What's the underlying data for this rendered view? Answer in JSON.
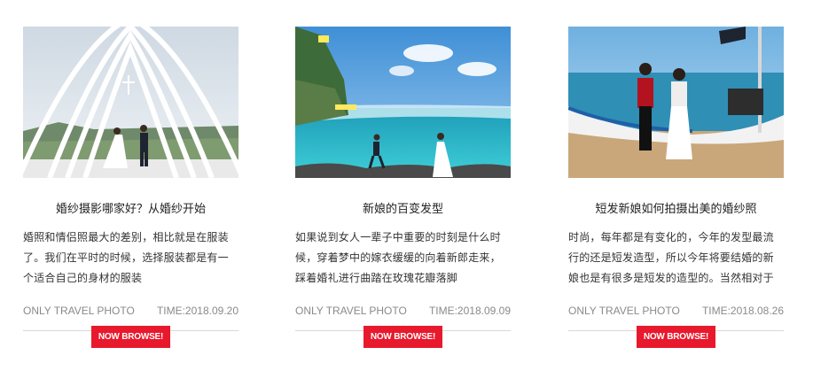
{
  "cards": [
    {
      "image_alt": "white chapel wedding photo",
      "title": "婚纱摄影哪家好？从婚纱开始",
      "description": "婚照和情侣照最大的差别，相比就是在服装了。我们在平时的时候，选择服装都是有一个适合自己的身材的服装",
      "brand": "ONLY TRAVEL PHOTO",
      "time": "TIME:2018.09.20",
      "button_label": "NOW BROWSE!"
    },
    {
      "image_alt": "seaside cliff wedding photo",
      "title": "新娘的百变发型",
      "description": "如果说到女人一辈子中重要的时刻是什么时候，穿着梦中的嫁衣缓缓的向着新郎走来，踩着婚礼进行曲踏在玫瑰花瓣落脚",
      "brand": "ONLY TRAVEL PHOTO",
      "time": "TIME:2018.09.09",
      "button_label": "NOW BROWSE!"
    },
    {
      "image_alt": "beach boat couple photo",
      "title": "短发新娘如何拍摄出美的婚纱照",
      "description": "时尚，每年都是有变化的，今年的发型最流行的还是短发造型，所以今年将要结婚的新娘也是有很多是短发的造型的。当然相对于",
      "brand": "ONLY TRAVEL PHOTO",
      "time": "TIME:2018.08.26",
      "button_label": "NOW BROWSE!"
    }
  ],
  "colors": {
    "accent": "#e8192c",
    "meta_text": "#8a8a8a",
    "divider": "#d8d8d8"
  }
}
